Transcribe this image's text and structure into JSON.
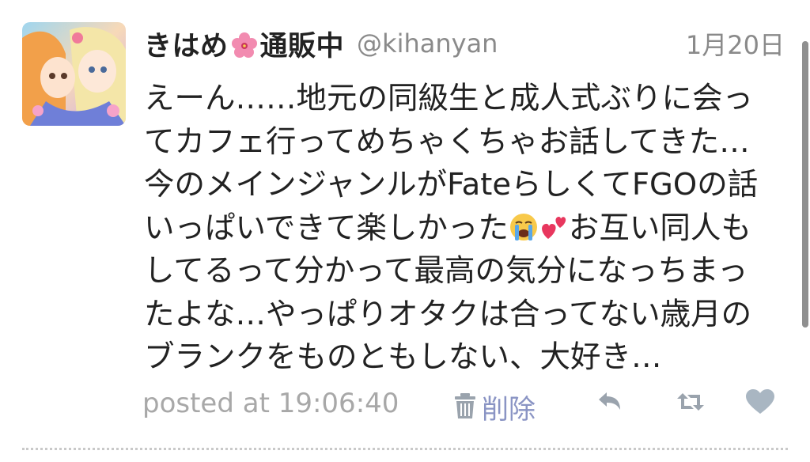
{
  "tweet": {
    "display_name": "きはめ",
    "name_emoji": "hibiscus-emoji",
    "display_name_suffix": "通販中",
    "handle": "@kihanyan",
    "date": "1月20日",
    "lines": [
      "えーん……地元の同級生と成人式ぶりに会っ",
      "てカフェ行ってめちゃくちゃお話してきた…",
      "今のメインジャンルがFateらしくてFGOの話",
      "いっぱいできて楽しかった",
      "お互い同人も",
      "してるって分かって最高の気分になっちまっ",
      "たよな…やっぱりオタクは合ってない歳月の",
      "ブランクをものともしない、大好き…"
    ],
    "inline_emojis": [
      "loudly-crying-face-emoji",
      "two-hearts-emoji"
    ]
  },
  "footer": {
    "posted_at": "posted at 19:06:40",
    "delete_label": "削除",
    "icons": [
      "trash-icon",
      "reply-icon",
      "retweet-icon",
      "heart-icon"
    ]
  },
  "colors": {
    "text": "#222222",
    "meta": "#8a8a8a",
    "delete": "#8a94c4",
    "icon": "#9aa3ad",
    "heart": "#a9b6c2"
  }
}
